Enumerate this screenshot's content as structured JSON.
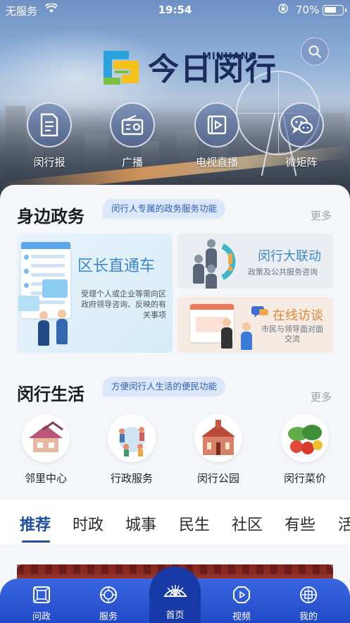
{
  "status_bar": {
    "carrier": "无服务",
    "time": "19:54",
    "battery_percent": "70%",
    "battery_level": 0.7
  },
  "header": {
    "logo_text": "今日闵行",
    "logo_sub": "MINHANG",
    "search_icon": "search-icon"
  },
  "quick_nav": [
    {
      "label": "闵行报",
      "icon": "newspaper-icon"
    },
    {
      "label": "广播",
      "icon": "radio-icon"
    },
    {
      "label": "电视直播",
      "icon": "tv-live-icon"
    },
    {
      "label": "微矩阵",
      "icon": "wechat-icon"
    }
  ],
  "gov_section": {
    "title": "身边政务",
    "tag": "闵行人专属的政务服务功能",
    "more": "更多",
    "card_main": {
      "title": "区长直通车",
      "desc": "受理个人或企业等需向区政府领导咨询、反映的有关事项"
    },
    "card_top": {
      "title": "闵行大联动",
      "sub": "政策及公共服务咨询"
    },
    "card_bottom": {
      "title": "在线访谈",
      "sub": "市民与领导面对面交流"
    }
  },
  "life_section": {
    "title": "闵行生活",
    "tag": "方便闵行人生活的便民功能",
    "more": "更多",
    "items": [
      {
        "label": "邻里中心"
      },
      {
        "label": "行政服务"
      },
      {
        "label": "闵行公园"
      },
      {
        "label": "闵行菜价"
      }
    ]
  },
  "tabs": [
    "推荐",
    "时政",
    "城事",
    "民生",
    "社区",
    "有些",
    "活"
  ],
  "bottom_nav": [
    {
      "label": "问政",
      "icon": "ask-gov-icon"
    },
    {
      "label": "服务",
      "icon": "service-icon"
    },
    {
      "label": "首页",
      "icon": "home-fan-icon"
    },
    {
      "label": "视频",
      "icon": "video-icon"
    },
    {
      "label": "我的",
      "icon": "profile-icon"
    }
  ],
  "colors": {
    "accent": "#1f4f9c",
    "nav_blue": "#2149c8",
    "tag_bg": "#dbe7fa",
    "orange": "#e2863a"
  }
}
